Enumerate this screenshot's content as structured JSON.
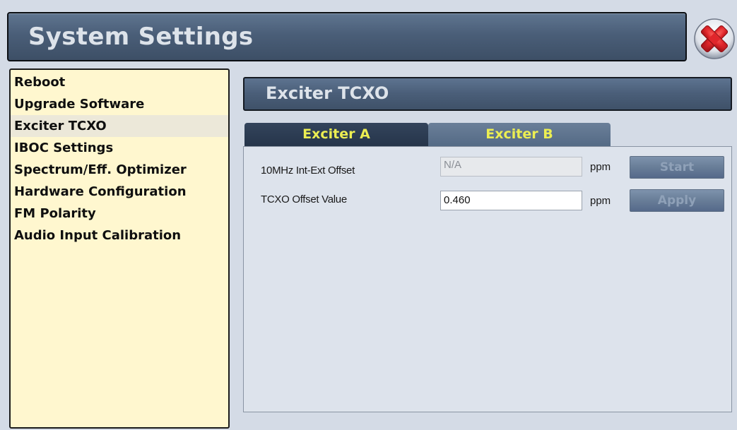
{
  "window": {
    "title": "System Settings",
    "close_icon": "close-icon (red circle with white X)"
  },
  "sidebar": {
    "selected_index": 2,
    "items": [
      {
        "label": "Reboot"
      },
      {
        "label": "Upgrade Software"
      },
      {
        "label": "Exciter TCXO"
      },
      {
        "label": "IBOC Settings"
      },
      {
        "label": "Spectrum/Eff. Optimizer"
      },
      {
        "label": "Hardware Configuration"
      },
      {
        "label": "FM Polarity"
      },
      {
        "label": "Audio Input Calibration"
      }
    ]
  },
  "main": {
    "section_title": "Exciter TCXO",
    "tabs": [
      {
        "label": "Exciter A",
        "active": true
      },
      {
        "label": "Exciter B",
        "active": false
      }
    ],
    "rows": [
      {
        "label": "10MHz Int-Ext Offset",
        "value": "N/A",
        "readonly": true,
        "unit": "ppm",
        "button_label": "Start",
        "button_enabled": false
      },
      {
        "label": "TCXO Offset Value",
        "value": "0.460",
        "readonly": false,
        "unit": "ppm",
        "button_label": "Apply",
        "button_enabled": false
      }
    ]
  },
  "colors": {
    "header_blue": "#4a5e78",
    "tab_text_yellow": "#ecee52",
    "nav_background": "#fff7cf",
    "close_red": "#e0262b"
  }
}
